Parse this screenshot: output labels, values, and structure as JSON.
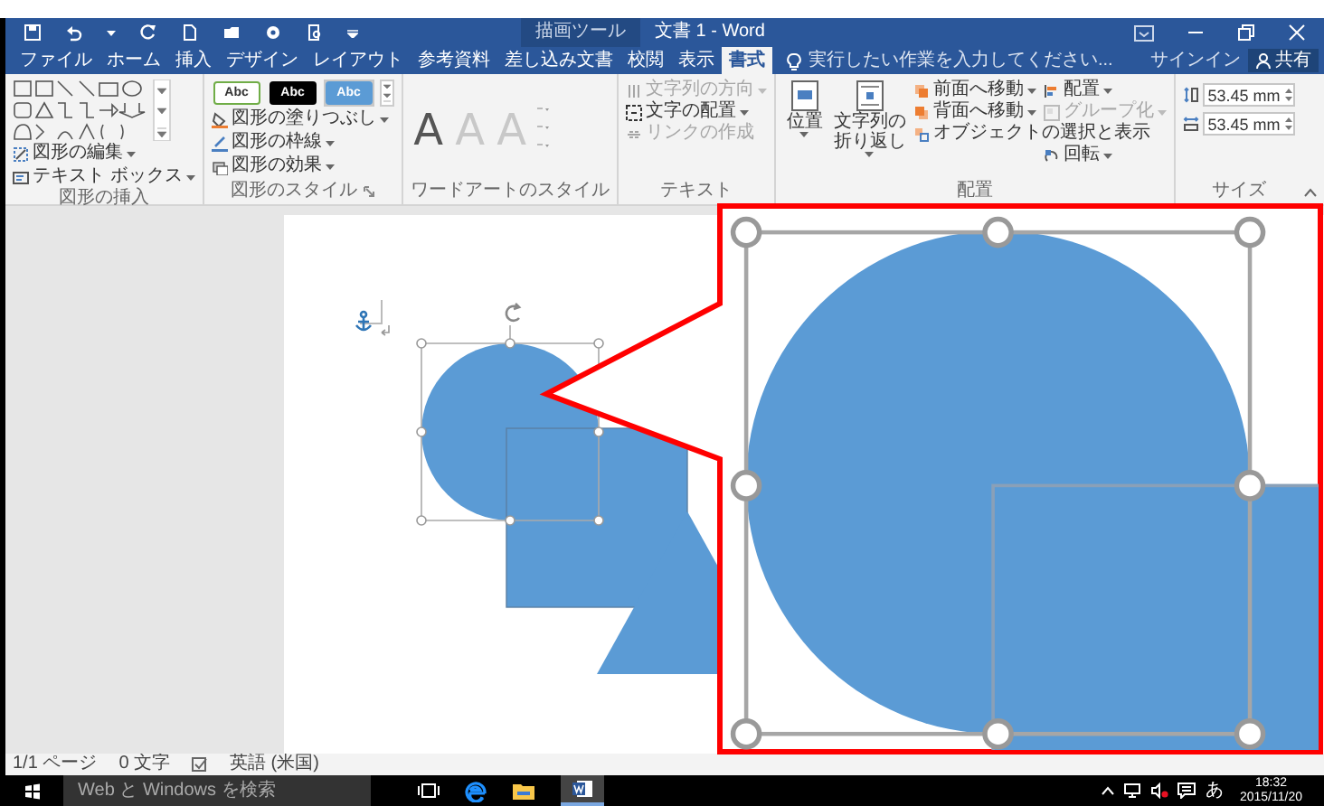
{
  "window": {
    "context_label": "描画ツール",
    "title": "文書 1 - Word"
  },
  "tabs": [
    {
      "label": "ファイル",
      "selected": false
    },
    {
      "label": "ホーム",
      "selected": false
    },
    {
      "label": "挿入",
      "selected": false
    },
    {
      "label": "デザイン",
      "selected": false
    },
    {
      "label": "レイアウト",
      "selected": false
    },
    {
      "label": "参考資料",
      "selected": false
    },
    {
      "label": "差し込み文書",
      "selected": false
    },
    {
      "label": "校閲",
      "selected": false
    },
    {
      "label": "表示",
      "selected": false
    },
    {
      "label": "書式",
      "selected": true
    }
  ],
  "tell_me": {
    "placeholder": "実行したい作業を入力してください..."
  },
  "sign_in": "サインイン",
  "share": "共有",
  "ribbon": {
    "insert_shapes": {
      "label": "図形の挿入",
      "commands": [
        "図形の編集",
        "テキスト ボックス"
      ]
    },
    "shape_styles": {
      "label": "図形のスタイル",
      "presets": [
        {
          "text": "Abc",
          "kind": "outline",
          "selected": false
        },
        {
          "text": "Abc",
          "kind": "dark",
          "selected": false
        },
        {
          "text": "Abc",
          "kind": "blue",
          "selected": true
        }
      ],
      "commands": [
        "図形の塗りつぶし",
        "図形の枠線",
        "図形の効果"
      ]
    },
    "wordart_styles": {
      "label": "ワードアートのスタイル",
      "presets": [
        {
          "text": "A",
          "kind": "dark"
        },
        {
          "text": "A",
          "kind": "light"
        },
        {
          "text": "A",
          "kind": "light"
        }
      ]
    },
    "text": {
      "label": "テキスト",
      "commands": [
        {
          "label": "文字列の方向",
          "disabled": true
        },
        {
          "label": "文字の配置",
          "disabled": false
        },
        {
          "label": "リンクの作成",
          "disabled": true
        }
      ]
    },
    "arrange": {
      "label": "配置",
      "large": [
        "位置",
        "文字列の折り返し"
      ],
      "commands": [
        {
          "label": "前面へ移動",
          "disabled": false
        },
        {
          "label": "背面へ移動",
          "disabled": false
        },
        {
          "label": "オブジェクトの選択と表示",
          "disabled": false
        },
        {
          "label": "配置",
          "disabled": false
        },
        {
          "label": "グループ化",
          "disabled": true
        },
        {
          "label": "回転",
          "disabled": false
        }
      ]
    },
    "size": {
      "label": "サイズ",
      "fields": [
        {
          "value": "53.45 mm"
        },
        {
          "value": "53.45 mm"
        }
      ]
    }
  },
  "status_bar": {
    "pages": "1/1 ページ",
    "words": "0 文字",
    "language": "英語 (米国)"
  },
  "taskbar": {
    "search": {
      "placeholder": "Web と Windows を検索"
    },
    "ime": "あ",
    "time": "18:32",
    "date": "2015/11/20"
  }
}
